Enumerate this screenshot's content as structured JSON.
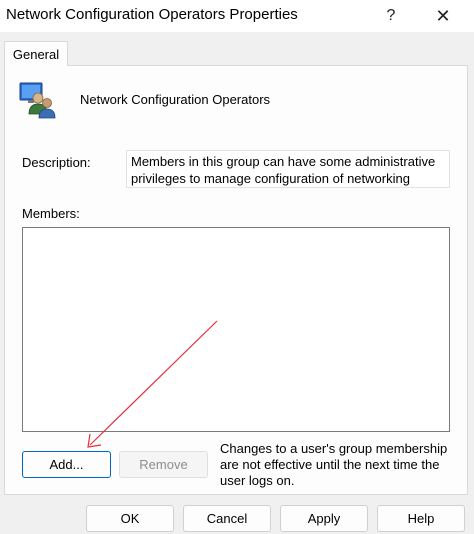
{
  "window": {
    "title": "Network Configuration Operators Properties",
    "help_label": "?",
    "close_label": "✕"
  },
  "tabs": [
    {
      "label": "General"
    }
  ],
  "group": {
    "name": "Network Configuration Operators"
  },
  "description": {
    "label": "Description:",
    "lines": [
      "Members in this group can have some administrative",
      "privileges to manage configuration of networking"
    ]
  },
  "members": {
    "label": "Members:",
    "items": []
  },
  "buttons": {
    "add": "Add...",
    "remove": "Remove",
    "ok": "OK",
    "cancel": "Cancel",
    "apply": "Apply",
    "help": "Help"
  },
  "note": {
    "lines": [
      "Changes to a user's group membership",
      "are not effective until the next time the",
      "user logs on."
    ]
  },
  "colors": {
    "annotation_arrow": "#e0303a",
    "accent": "#0067c0"
  },
  "icons": {
    "group": "users-group-icon",
    "help": "help-icon",
    "close": "close-icon"
  }
}
